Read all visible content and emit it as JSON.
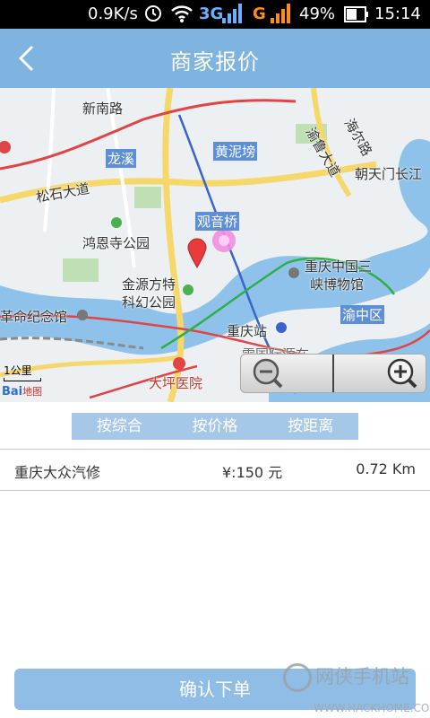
{
  "status": {
    "speed": "0.9K/s",
    "net_3g": "3G",
    "net_g": "G",
    "battery": "49%",
    "time": "15:14"
  },
  "header": {
    "title": "商家报价",
    "back_icon": "back-arrow-icon"
  },
  "map": {
    "labels": [
      "新南路",
      "龙溪",
      "黄泥塝",
      "渝鲁大道",
      "海尔路",
      "朝天门长江",
      "松石大道",
      "观音桥",
      "鸿恩寺公园",
      "重庆中国三",
      "峡博物馆",
      "金源方特",
      "科幻公园",
      "渝中区",
      "革命纪念馆",
      "重庆站",
      "大坪医院",
      "雪国际源在"
    ],
    "scale": "1公里",
    "logo_main": "Bai",
    "logo_sub": "地图"
  },
  "sort_tabs": [
    "按综合",
    "按价格",
    "按距离"
  ],
  "merchants": [
    {
      "name": "重庆大众汽修",
      "price": "¥:150 元",
      "distance": "0.72 Km"
    }
  ],
  "confirm_label": "确认下单",
  "watermark": {
    "cn": "网侠手机站",
    "url": "WWW.HACKHOME.COM"
  },
  "colors": {
    "header": "#7fb3e0",
    "button": "#8fbde5",
    "tabs": "#a6c8e8",
    "river": "#8ec2ea"
  }
}
